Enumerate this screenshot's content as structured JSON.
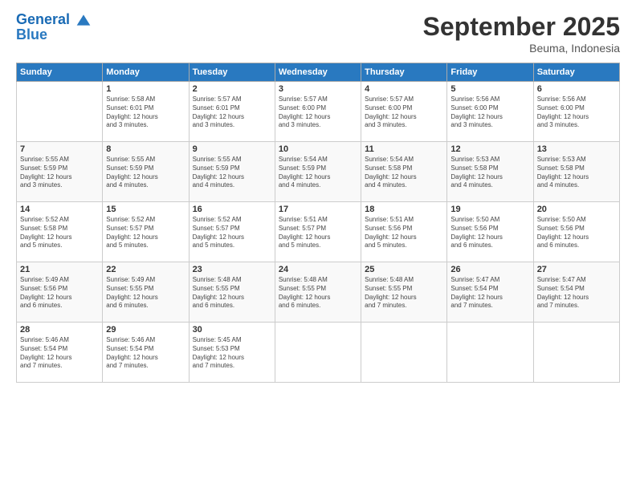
{
  "header": {
    "logo_line1": "General",
    "logo_line2": "Blue",
    "month_title": "September 2025",
    "location": "Beuma, Indonesia"
  },
  "days_of_week": [
    "Sunday",
    "Monday",
    "Tuesday",
    "Wednesday",
    "Thursday",
    "Friday",
    "Saturday"
  ],
  "weeks": [
    [
      {
        "day": "",
        "info": ""
      },
      {
        "day": "1",
        "info": "Sunrise: 5:58 AM\nSunset: 6:01 PM\nDaylight: 12 hours\nand 3 minutes."
      },
      {
        "day": "2",
        "info": "Sunrise: 5:57 AM\nSunset: 6:01 PM\nDaylight: 12 hours\nand 3 minutes."
      },
      {
        "day": "3",
        "info": "Sunrise: 5:57 AM\nSunset: 6:00 PM\nDaylight: 12 hours\nand 3 minutes."
      },
      {
        "day": "4",
        "info": "Sunrise: 5:57 AM\nSunset: 6:00 PM\nDaylight: 12 hours\nand 3 minutes."
      },
      {
        "day": "5",
        "info": "Sunrise: 5:56 AM\nSunset: 6:00 PM\nDaylight: 12 hours\nand 3 minutes."
      },
      {
        "day": "6",
        "info": "Sunrise: 5:56 AM\nSunset: 6:00 PM\nDaylight: 12 hours\nand 3 minutes."
      }
    ],
    [
      {
        "day": "7",
        "info": "Sunrise: 5:55 AM\nSunset: 5:59 PM\nDaylight: 12 hours\nand 3 minutes."
      },
      {
        "day": "8",
        "info": "Sunrise: 5:55 AM\nSunset: 5:59 PM\nDaylight: 12 hours\nand 4 minutes."
      },
      {
        "day": "9",
        "info": "Sunrise: 5:55 AM\nSunset: 5:59 PM\nDaylight: 12 hours\nand 4 minutes."
      },
      {
        "day": "10",
        "info": "Sunrise: 5:54 AM\nSunset: 5:59 PM\nDaylight: 12 hours\nand 4 minutes."
      },
      {
        "day": "11",
        "info": "Sunrise: 5:54 AM\nSunset: 5:58 PM\nDaylight: 12 hours\nand 4 minutes."
      },
      {
        "day": "12",
        "info": "Sunrise: 5:53 AM\nSunset: 5:58 PM\nDaylight: 12 hours\nand 4 minutes."
      },
      {
        "day": "13",
        "info": "Sunrise: 5:53 AM\nSunset: 5:58 PM\nDaylight: 12 hours\nand 4 minutes."
      }
    ],
    [
      {
        "day": "14",
        "info": "Sunrise: 5:52 AM\nSunset: 5:58 PM\nDaylight: 12 hours\nand 5 minutes."
      },
      {
        "day": "15",
        "info": "Sunrise: 5:52 AM\nSunset: 5:57 PM\nDaylight: 12 hours\nand 5 minutes."
      },
      {
        "day": "16",
        "info": "Sunrise: 5:52 AM\nSunset: 5:57 PM\nDaylight: 12 hours\nand 5 minutes."
      },
      {
        "day": "17",
        "info": "Sunrise: 5:51 AM\nSunset: 5:57 PM\nDaylight: 12 hours\nand 5 minutes."
      },
      {
        "day": "18",
        "info": "Sunrise: 5:51 AM\nSunset: 5:56 PM\nDaylight: 12 hours\nand 5 minutes."
      },
      {
        "day": "19",
        "info": "Sunrise: 5:50 AM\nSunset: 5:56 PM\nDaylight: 12 hours\nand 6 minutes."
      },
      {
        "day": "20",
        "info": "Sunrise: 5:50 AM\nSunset: 5:56 PM\nDaylight: 12 hours\nand 6 minutes."
      }
    ],
    [
      {
        "day": "21",
        "info": "Sunrise: 5:49 AM\nSunset: 5:56 PM\nDaylight: 12 hours\nand 6 minutes."
      },
      {
        "day": "22",
        "info": "Sunrise: 5:49 AM\nSunset: 5:55 PM\nDaylight: 12 hours\nand 6 minutes."
      },
      {
        "day": "23",
        "info": "Sunrise: 5:48 AM\nSunset: 5:55 PM\nDaylight: 12 hours\nand 6 minutes."
      },
      {
        "day": "24",
        "info": "Sunrise: 5:48 AM\nSunset: 5:55 PM\nDaylight: 12 hours\nand 6 minutes."
      },
      {
        "day": "25",
        "info": "Sunrise: 5:48 AM\nSunset: 5:55 PM\nDaylight: 12 hours\nand 7 minutes."
      },
      {
        "day": "26",
        "info": "Sunrise: 5:47 AM\nSunset: 5:54 PM\nDaylight: 12 hours\nand 7 minutes."
      },
      {
        "day": "27",
        "info": "Sunrise: 5:47 AM\nSunset: 5:54 PM\nDaylight: 12 hours\nand 7 minutes."
      }
    ],
    [
      {
        "day": "28",
        "info": "Sunrise: 5:46 AM\nSunset: 5:54 PM\nDaylight: 12 hours\nand 7 minutes."
      },
      {
        "day": "29",
        "info": "Sunrise: 5:46 AM\nSunset: 5:54 PM\nDaylight: 12 hours\nand 7 minutes."
      },
      {
        "day": "30",
        "info": "Sunrise: 5:45 AM\nSunset: 5:53 PM\nDaylight: 12 hours\nand 7 minutes."
      },
      {
        "day": "",
        "info": ""
      },
      {
        "day": "",
        "info": ""
      },
      {
        "day": "",
        "info": ""
      },
      {
        "day": "",
        "info": ""
      }
    ]
  ]
}
